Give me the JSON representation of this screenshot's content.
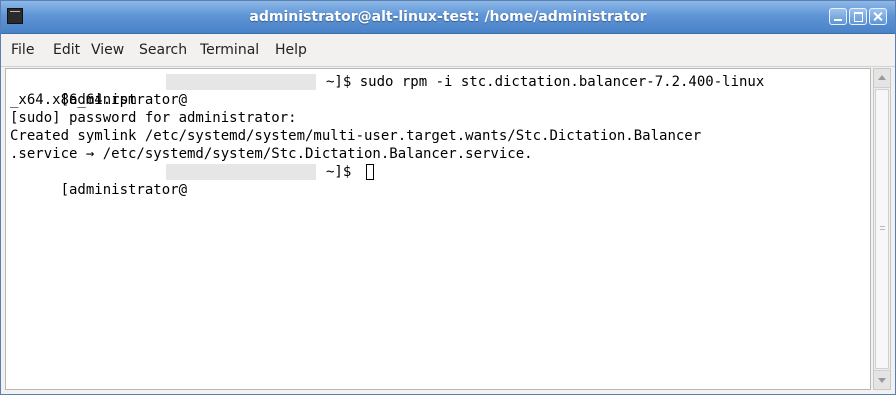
{
  "window": {
    "title": "administrator@alt-linux-test: /home/administrator",
    "app_icon": "terminal-icon",
    "accent_color": "#5f95d6"
  },
  "menu": {
    "items": [
      "File",
      "Edit",
      "View",
      "Search",
      "Terminal",
      "Help"
    ]
  },
  "terminal": {
    "prompt_user": "[administrator@",
    "lines": [
      {
        "after_redaction": "~]$ sudo rpm -i stc.dictation.balancer-7.2.400-linux"
      },
      {
        "text": "_x64.x86_64.rpm"
      },
      {
        "text": "[sudo] password for administrator:"
      },
      {
        "text": "Created symlink /etc/systemd/system/multi-user.target.wants/Stc.Dictation.Balancer"
      },
      {
        "text": ".service → /etc/systemd/system/Stc.Dictation.Balancer.service."
      },
      {
        "after_redaction": "~]$ "
      }
    ]
  },
  "scrollbar": {
    "up_icon": "arrow-up-icon",
    "down_icon": "arrow-down-icon"
  }
}
